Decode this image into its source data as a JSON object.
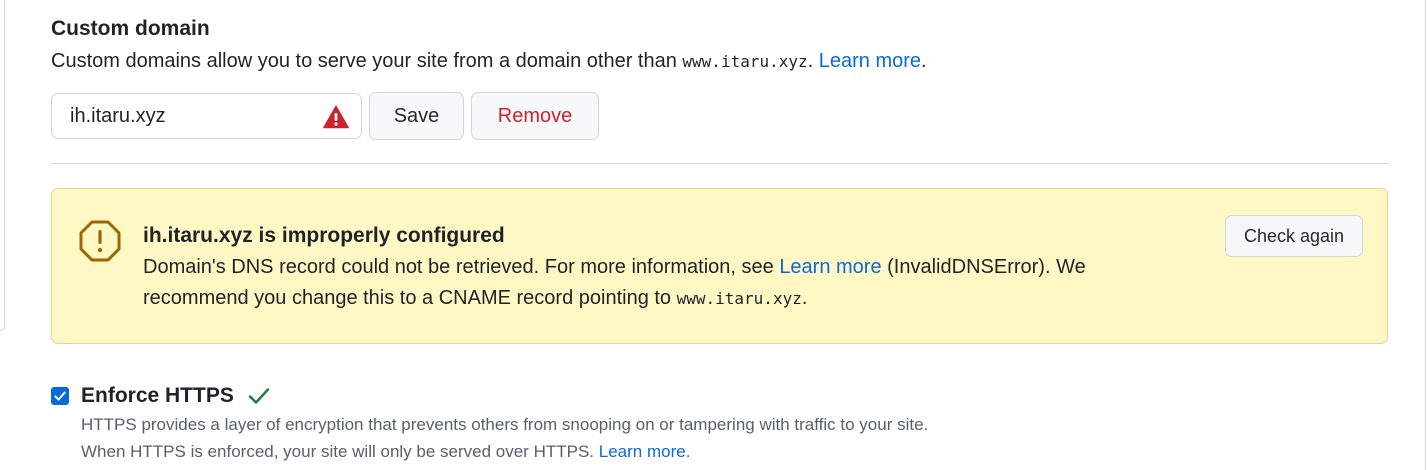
{
  "custom_domain": {
    "title": "Custom domain",
    "description_prefix": "Custom domains allow you to serve your site from a domain other than ",
    "description_code": "www.itaru.xyz",
    "description_suffix": ". ",
    "learn_more": "Learn more",
    "description_end": ".",
    "input_value": "ih.itaru.xyz",
    "save_label": "Save",
    "remove_label": "Remove"
  },
  "warning": {
    "title": "ih.itaru.xyz is improperly configured",
    "body_prefix": "Domain's DNS record could not be retrieved. For more information, see ",
    "learn_more": "Learn more",
    "body_middle": " (InvalidDNSError). We recommend you change this to a CNAME record pointing to ",
    "body_code": "www.itaru.xyz",
    "body_end": ".",
    "check_again_label": "Check again"
  },
  "https": {
    "label": "Enforce HTTPS",
    "checked": true,
    "line1": "HTTPS provides a layer of encryption that prevents others from snooping on or tampering with traffic to your site.",
    "line2_prefix": "When HTTPS is enforced, your site will only be served over HTTPS. ",
    "learn_more": "Learn more",
    "line2_end": "."
  },
  "colors": {
    "link": "#0969da",
    "danger": "#cf222e",
    "warning_bg": "#fff8c5",
    "warning_icon": "#9a6700",
    "success": "#1a7f37"
  },
  "icons": {
    "input_warning": "alert-triangle-icon",
    "flash_warning": "alert-octagon-icon",
    "https_ok": "check-icon",
    "checkbox": "checkbox-checked"
  }
}
